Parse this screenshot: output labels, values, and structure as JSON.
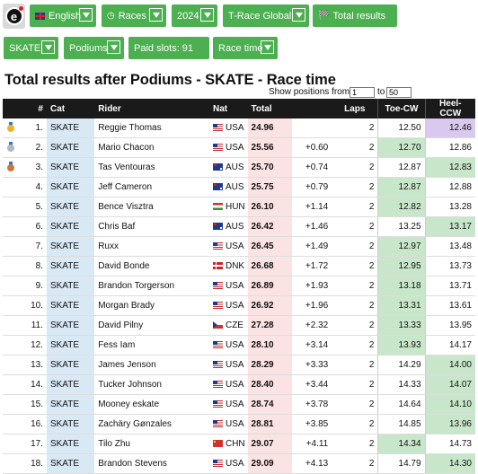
{
  "toolbar": {
    "language": "English",
    "races": "Races",
    "year": "2024",
    "series": "T-Race Global",
    "results": "Total results",
    "category": "SKATE",
    "podiums": "Podiums",
    "paid_slots": "Paid slots: 91",
    "race_time": "Race time"
  },
  "icons": {
    "logo": "logo-icon",
    "language": "uk-flag-icon",
    "races": "clock-icon",
    "results": "checkered-flag-icon"
  },
  "page_title": "Total results after Podiums - SKATE - Race time",
  "show_positions": {
    "label": "Show positions from:",
    "from": "1",
    "to_label": "to",
    "to": "50"
  },
  "colors": {
    "accent": "#4caf50",
    "toe_best": "#c8e6c9",
    "highlight": "#d9c9ee",
    "total_bg": "#fbe3e4",
    "cat_bg": "#d9e8f5"
  },
  "table": {
    "headers": {
      "num": "#",
      "cat": "Cat",
      "rider": "Rider",
      "nat": "Nat",
      "total": "Total",
      "laps": "Laps",
      "toe": "Toe-CW",
      "heel": "Heel-CCW"
    },
    "rows": [
      {
        "medal": "gold",
        "num": "1.",
        "cat": "SKATE",
        "rider": "Reggie Thomas",
        "flag": "usa",
        "nat": "USA",
        "total": "24.96",
        "diff": "",
        "laps": "2",
        "toe": "12.50",
        "heel": "12.46",
        "toe_g": false,
        "heel_g": false,
        "heel_hl": true
      },
      {
        "medal": "silver",
        "num": "2.",
        "cat": "SKATE",
        "rider": "Mario Chacon",
        "flag": "usa",
        "nat": "USA",
        "total": "25.56",
        "diff": "+0.60",
        "laps": "2",
        "toe": "12.70",
        "heel": "12.86",
        "toe_g": true,
        "heel_g": false
      },
      {
        "medal": "bronze",
        "num": "3.",
        "cat": "SKATE",
        "rider": "Tas Ventouras",
        "flag": "aus",
        "nat": "AUS",
        "total": "25.70",
        "diff": "+0.74",
        "laps": "2",
        "toe": "12.87",
        "heel": "12.83",
        "toe_g": false,
        "heel_g": true
      },
      {
        "medal": "",
        "num": "4.",
        "cat": "SKATE",
        "rider": "Jeff Cameron",
        "flag": "aus",
        "nat": "AUS",
        "total": "25.75",
        "diff": "+0.79",
        "laps": "2",
        "toe": "12.87",
        "heel": "12.88",
        "toe_g": true,
        "heel_g": false
      },
      {
        "medal": "",
        "num": "5.",
        "cat": "SKATE",
        "rider": "Bence Visztra",
        "flag": "hun",
        "nat": "HUN",
        "total": "26.10",
        "diff": "+1.14",
        "laps": "2",
        "toe": "12.82",
        "heel": "13.28",
        "toe_g": true,
        "heel_g": false
      },
      {
        "medal": "",
        "num": "6.",
        "cat": "SKATE",
        "rider": "Chris Baf",
        "flag": "aus",
        "nat": "AUS",
        "total": "26.42",
        "diff": "+1.46",
        "laps": "2",
        "toe": "13.25",
        "heel": "13.17",
        "toe_g": false,
        "heel_g": true
      },
      {
        "medal": "",
        "num": "7.",
        "cat": "SKATE",
        "rider": "Ruxx",
        "flag": "usa",
        "nat": "USA",
        "total": "26.45",
        "diff": "+1.49",
        "laps": "2",
        "toe": "12.97",
        "heel": "13.48",
        "toe_g": true,
        "heel_g": false
      },
      {
        "medal": "",
        "num": "8.",
        "cat": "SKATE",
        "rider": "David Bonde",
        "flag": "dnk",
        "nat": "DNK",
        "total": "26.68",
        "diff": "+1.72",
        "laps": "2",
        "toe": "12.95",
        "heel": "13.73",
        "toe_g": true,
        "heel_g": false
      },
      {
        "medal": "",
        "num": "9.",
        "cat": "SKATE",
        "rider": "Brandon Torgerson",
        "flag": "usa",
        "nat": "USA",
        "total": "26.89",
        "diff": "+1.93",
        "laps": "2",
        "toe": "13.18",
        "heel": "13.71",
        "toe_g": true,
        "heel_g": false
      },
      {
        "medal": "",
        "num": "10.",
        "cat": "SKATE",
        "rider": "Morgan Brady",
        "flag": "usa",
        "nat": "USA",
        "total": "26.92",
        "diff": "+1.96",
        "laps": "2",
        "toe": "13.31",
        "heel": "13.61",
        "toe_g": true,
        "heel_g": false
      },
      {
        "medal": "",
        "num": "11.",
        "cat": "SKATE",
        "rider": "David Pilny",
        "flag": "cze",
        "nat": "CZE",
        "total": "27.28",
        "diff": "+2.32",
        "laps": "2",
        "toe": "13.33",
        "heel": "13.95",
        "toe_g": true,
        "heel_g": false
      },
      {
        "medal": "",
        "num": "12.",
        "cat": "SKATE",
        "rider": "Fess Iam",
        "flag": "usa",
        "nat": "USA",
        "total": "28.10",
        "diff": "+3.14",
        "laps": "2",
        "toe": "13.93",
        "heel": "14.17",
        "toe_g": true,
        "heel_g": false
      },
      {
        "medal": "",
        "num": "13.",
        "cat": "SKATE",
        "rider": "James Jenson",
        "flag": "usa",
        "nat": "USA",
        "total": "28.29",
        "diff": "+3.33",
        "laps": "2",
        "toe": "14.29",
        "heel": "14.00",
        "toe_g": false,
        "heel_g": true
      },
      {
        "medal": "",
        "num": "14.",
        "cat": "SKATE",
        "rider": "Tucker Johnson",
        "flag": "usa",
        "nat": "USA",
        "total": "28.40",
        "diff": "+3.44",
        "laps": "2",
        "toe": "14.33",
        "heel": "14.07",
        "toe_g": false,
        "heel_g": true
      },
      {
        "medal": "",
        "num": "15.",
        "cat": "SKATE",
        "rider": "Mooney eskate",
        "flag": "usa",
        "nat": "USA",
        "total": "28.74",
        "diff": "+3.78",
        "laps": "2",
        "toe": "14.64",
        "heel": "14.10",
        "toe_g": false,
        "heel_g": true
      },
      {
        "medal": "",
        "num": "16.",
        "cat": "SKATE",
        "rider": "Zachäry Gønzales",
        "flag": "usa",
        "nat": "USA",
        "total": "28.81",
        "diff": "+3.85",
        "laps": "2",
        "toe": "14.85",
        "heel": "13.96",
        "toe_g": false,
        "heel_g": true
      },
      {
        "medal": "",
        "num": "17.",
        "cat": "SKATE",
        "rider": "Tilo Zhu",
        "flag": "chn",
        "nat": "CHN",
        "total": "29.07",
        "diff": "+4.11",
        "laps": "2",
        "toe": "14.34",
        "heel": "14.73",
        "toe_g": true,
        "heel_g": false
      },
      {
        "medal": "",
        "num": "18.",
        "cat": "SKATE",
        "rider": "Brandon Stevens",
        "flag": "usa",
        "nat": "USA",
        "total": "29.09",
        "diff": "+4.13",
        "laps": "2",
        "toe": "14.79",
        "heel": "14.30",
        "toe_g": false,
        "heel_g": true
      }
    ]
  }
}
